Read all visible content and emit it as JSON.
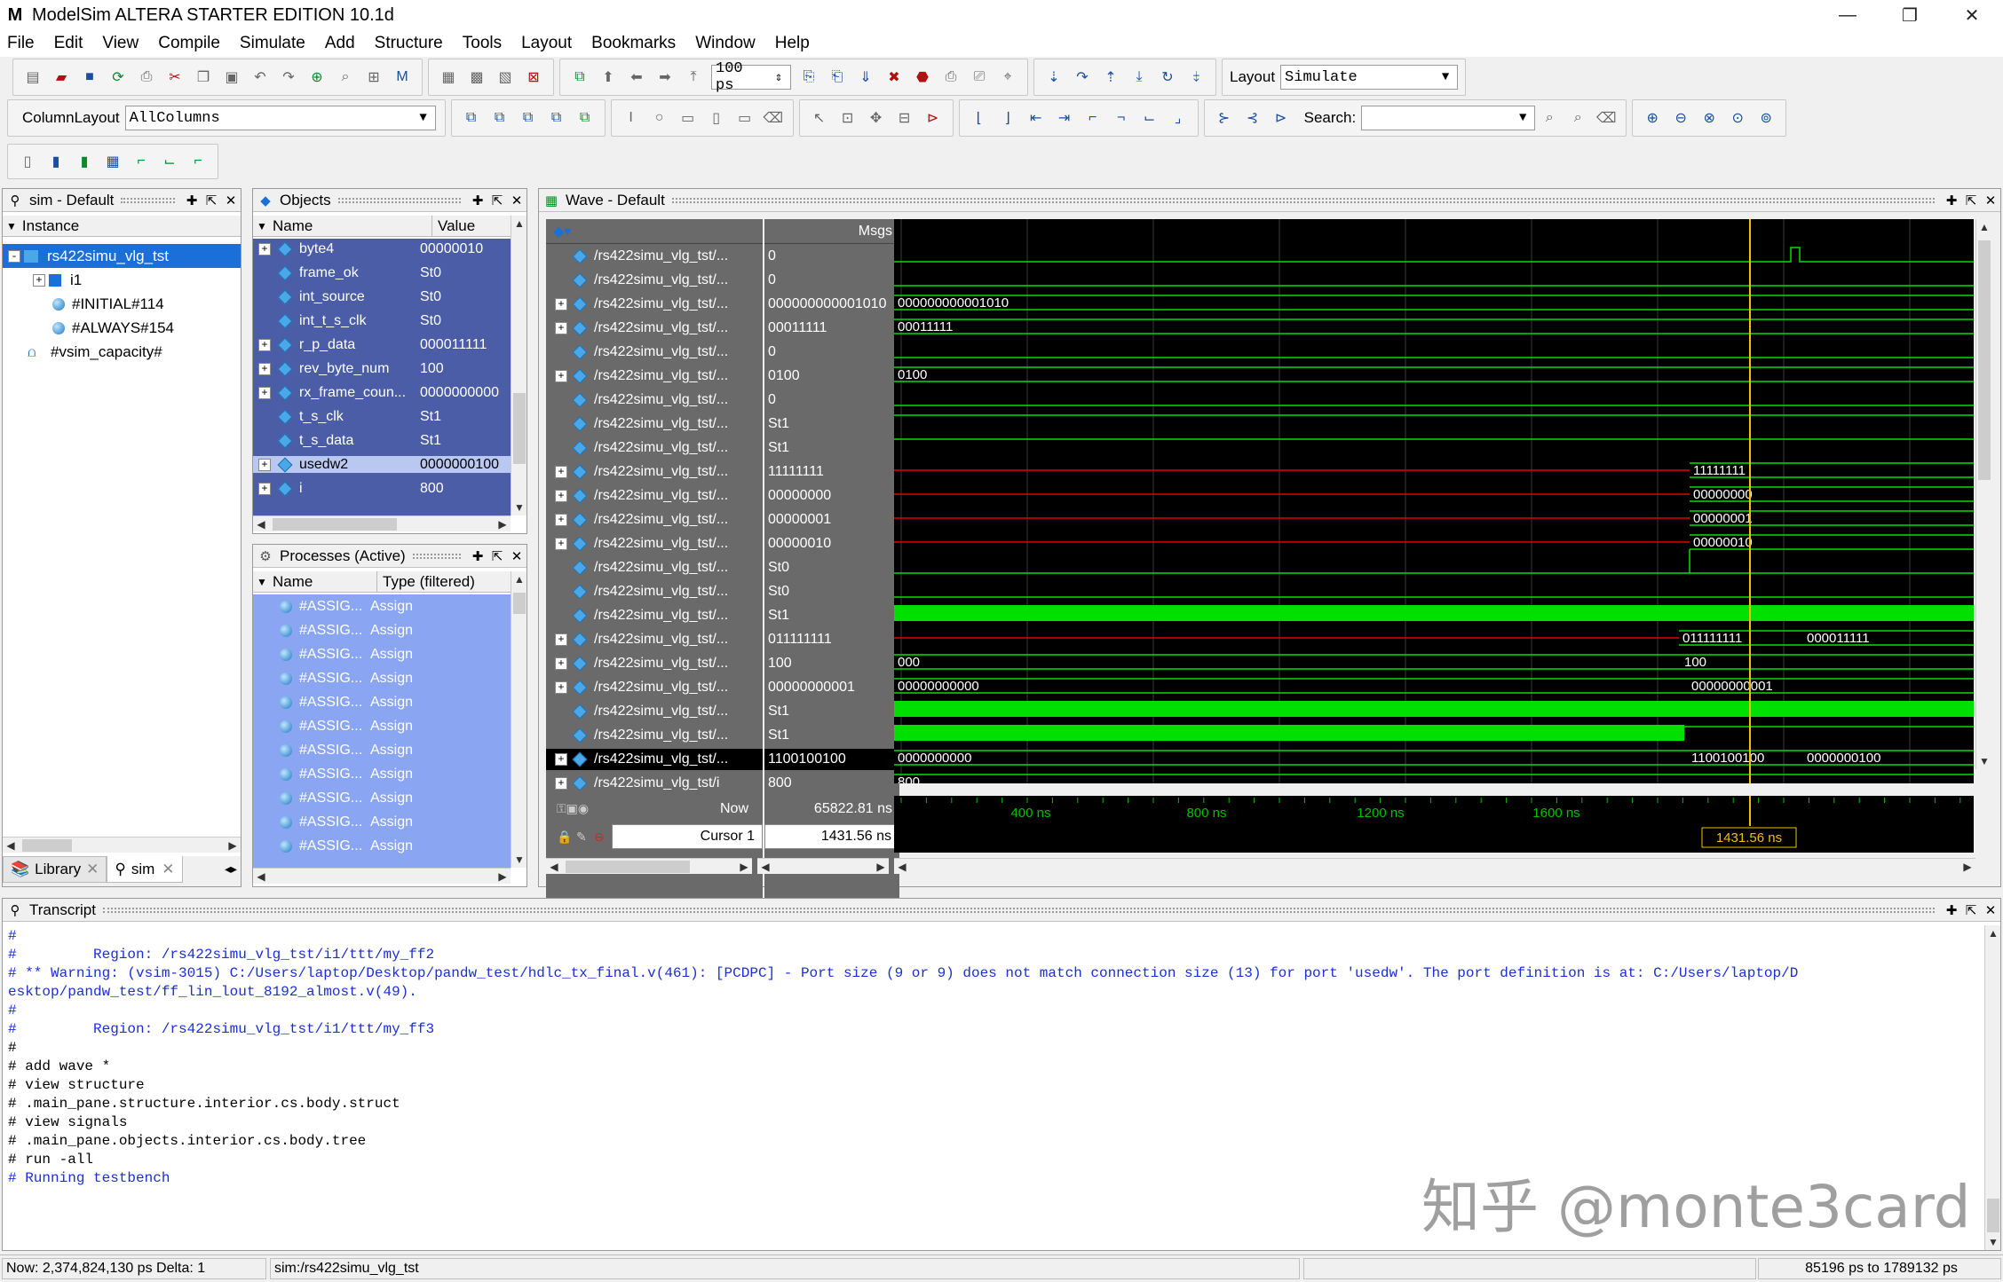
{
  "window": {
    "title": "ModelSim ALTERA STARTER EDITION 10.1d",
    "app_icon": "M",
    "min": "—",
    "max": "❐",
    "close": "✕"
  },
  "menu": [
    "File",
    "Edit",
    "View",
    "Compile",
    "Simulate",
    "Add",
    "Structure",
    "Tools",
    "Layout",
    "Bookmarks",
    "Window",
    "Help"
  ],
  "toolbar": {
    "run_length": "100 ps",
    "layout_label": "Layout",
    "layout_value": "Simulate",
    "column_layout_label": "ColumnLayout",
    "column_layout_value": "AllColumns",
    "search_label": "Search:"
  },
  "sim_panel": {
    "title": "sim - Default",
    "column": "Instance",
    "items": [
      {
        "label": "rs422simu_vlg_tst",
        "level": 0,
        "expand": "-",
        "icon": "module-icon",
        "selected": true
      },
      {
        "label": "i1",
        "level": 1,
        "expand": "+",
        "icon": "module-icon"
      },
      {
        "label": "#INITIAL#114",
        "level": 1,
        "expand": "",
        "icon": "process-icon"
      },
      {
        "label": "#ALWAYS#154",
        "level": 1,
        "expand": "",
        "icon": "process-icon"
      },
      {
        "label": "#vsim_capacity#",
        "level": 0,
        "expand": "",
        "icon": "capacity-icon"
      }
    ],
    "tabs": [
      "Library",
      "sim"
    ]
  },
  "objects_panel": {
    "title": "Objects",
    "columns": [
      "Name",
      "Value"
    ],
    "rows": [
      {
        "expand": "+",
        "name": "byte4",
        "value": "00000010"
      },
      {
        "expand": "",
        "name": "frame_ok",
        "value": "St0"
      },
      {
        "expand": "",
        "name": "int_source",
        "value": "St0"
      },
      {
        "expand": "",
        "name": "int_t_s_clk",
        "value": "St0"
      },
      {
        "expand": "+",
        "name": "r_p_data",
        "value": "000011111"
      },
      {
        "expand": "+",
        "name": "rev_byte_num",
        "value": "100"
      },
      {
        "expand": "+",
        "name": "rx_frame_coun...",
        "value": "0000000000"
      },
      {
        "expand": "",
        "name": "t_s_clk",
        "value": "St1"
      },
      {
        "expand": "",
        "name": "t_s_data",
        "value": "St1"
      },
      {
        "expand": "+",
        "name": "usedw2",
        "value": "0000000100"
      },
      {
        "expand": "+",
        "name": "i",
        "value": "800"
      }
    ]
  },
  "processes_panel": {
    "title": "Processes (Active)",
    "columns": [
      "Name",
      "Type (filtered)"
    ],
    "rows": [
      {
        "name": "#ASSIG...",
        "type": "Assign"
      },
      {
        "name": "#ASSIG...",
        "type": "Assign"
      },
      {
        "name": "#ASSIG...",
        "type": "Assign"
      },
      {
        "name": "#ASSIG...",
        "type": "Assign"
      },
      {
        "name": "#ASSIG...",
        "type": "Assign"
      },
      {
        "name": "#ASSIG...",
        "type": "Assign"
      },
      {
        "name": "#ASSIG...",
        "type": "Assign"
      },
      {
        "name": "#ASSIG...",
        "type": "Assign"
      },
      {
        "name": "#ASSIG...",
        "type": "Assign"
      },
      {
        "name": "#ASSIG...",
        "type": "Assign"
      },
      {
        "name": "#ASSIG...",
        "type": "Assign"
      }
    ]
  },
  "wave_panel": {
    "title": "Wave - Default",
    "msgs_label": "Msgs",
    "now_label": "Now",
    "now_value": "65822.81 ns",
    "cursor_label": "Cursor 1",
    "cursor_value": "1431.56 ns",
    "cursor_flag": "1431.56 ns",
    "time_ticks": [
      "400 ns",
      "800 ns",
      "1200 ns",
      "1600 ns"
    ],
    "signals": [
      {
        "name": "/rs422simu_vlg_tst/...",
        "expand": "",
        "value": "0"
      },
      {
        "name": "/rs422simu_vlg_tst/...",
        "expand": "",
        "value": "0"
      },
      {
        "name": "/rs422simu_vlg_tst/...",
        "expand": "+",
        "value": "000000000001010"
      },
      {
        "name": "/rs422simu_vlg_tst/...",
        "expand": "+",
        "value": "00011111"
      },
      {
        "name": "/rs422simu_vlg_tst/...",
        "expand": "",
        "value": "0"
      },
      {
        "name": "/rs422simu_vlg_tst/...",
        "expand": "+",
        "value": "0100"
      },
      {
        "name": "/rs422simu_vlg_tst/...",
        "expand": "",
        "value": "0"
      },
      {
        "name": "/rs422simu_vlg_tst/...",
        "expand": "",
        "value": "St1"
      },
      {
        "name": "/rs422simu_vlg_tst/...",
        "expand": "",
        "value": "St1"
      },
      {
        "name": "/rs422simu_vlg_tst/...",
        "expand": "+",
        "value": "11111111"
      },
      {
        "name": "/rs422simu_vlg_tst/...",
        "expand": "+",
        "value": "00000000"
      },
      {
        "name": "/rs422simu_vlg_tst/...",
        "expand": "+",
        "value": "00000001"
      },
      {
        "name": "/rs422simu_vlg_tst/...",
        "expand": "+",
        "value": "00000010"
      },
      {
        "name": "/rs422simu_vlg_tst/...",
        "expand": "",
        "value": "St0"
      },
      {
        "name": "/rs422simu_vlg_tst/...",
        "expand": "",
        "value": "St0"
      },
      {
        "name": "/rs422simu_vlg_tst/...",
        "expand": "",
        "value": "St1"
      },
      {
        "name": "/rs422simu_vlg_tst/...",
        "expand": "+",
        "value": "011111111"
      },
      {
        "name": "/rs422simu_vlg_tst/...",
        "expand": "+",
        "value": "100"
      },
      {
        "name": "/rs422simu_vlg_tst/...",
        "expand": "+",
        "value": "00000000001"
      },
      {
        "name": "/rs422simu_vlg_tst/...",
        "expand": "",
        "value": "St1"
      },
      {
        "name": "/rs422simu_vlg_tst/...",
        "expand": "",
        "value": "St1"
      },
      {
        "name": "/rs422simu_vlg_tst/...",
        "expand": "+",
        "value": "1100100100"
      },
      {
        "name": "/rs422simu_vlg_tst/i",
        "expand": "+",
        "value": "800"
      }
    ],
    "wave_labels": {
      "r2": "000000000001010",
      "r3": "00011111",
      "r5": "0100",
      "r9": "11111111",
      "r10": "00000000",
      "r11": "00000001",
      "r12": "00000010",
      "r16a": "011111111",
      "r16b": "000011111",
      "r17a": "000",
      "r17b": "100",
      "r18a": "00000000000",
      "r18b": "00000000001",
      "r21a": "0000000000",
      "r21b": "1100100100",
      "r21c": "0000000100",
      "r22": "800"
    }
  },
  "transcript": {
    "title": "Transcript",
    "lines": [
      {
        "text": "#",
        "color": "blue"
      },
      {
        "text": "#         Region: /rs422simu_vlg_tst/i1/ttt/my_ff2",
        "color": "blue"
      },
      {
        "text": "# ** Warning: (vsim-3015) C:/Users/laptop/Desktop/pandw_test/hdlc_tx_final.v(461): [PCDPC] - Port size (9 or 9) does not match connection size (13) for port 'usedw'. The port definition is at: C:/Users/laptop/D",
        "color": "blue"
      },
      {
        "text": "esktop/pandw_test/ff_lin_lout_8192_almost.v(49).",
        "color": "blue"
      },
      {
        "text": "#",
        "color": "blue"
      },
      {
        "text": "#         Region: /rs422simu_vlg_tst/i1/ttt/my_ff3",
        "color": "blue"
      },
      {
        "text": "#",
        "color": "black"
      },
      {
        "text": "# add wave *",
        "color": "black"
      },
      {
        "text": "# view structure",
        "color": "black"
      },
      {
        "text": "# .main_pane.structure.interior.cs.body.struct",
        "color": "black"
      },
      {
        "text": "# view signals",
        "color": "black"
      },
      {
        "text": "# .main_pane.objects.interior.cs.body.tree",
        "color": "black"
      },
      {
        "text": "# run -all",
        "color": "black"
      },
      {
        "text": "# Running testbench",
        "color": "blue"
      }
    ]
  },
  "status": {
    "now": "Now: 2,374,824,130 ps  Delta: 1",
    "context": "sim:/rs422simu_vlg_tst",
    "range": "85196 ps to 1789132 ps"
  },
  "watermark": "知乎 @monte3card"
}
